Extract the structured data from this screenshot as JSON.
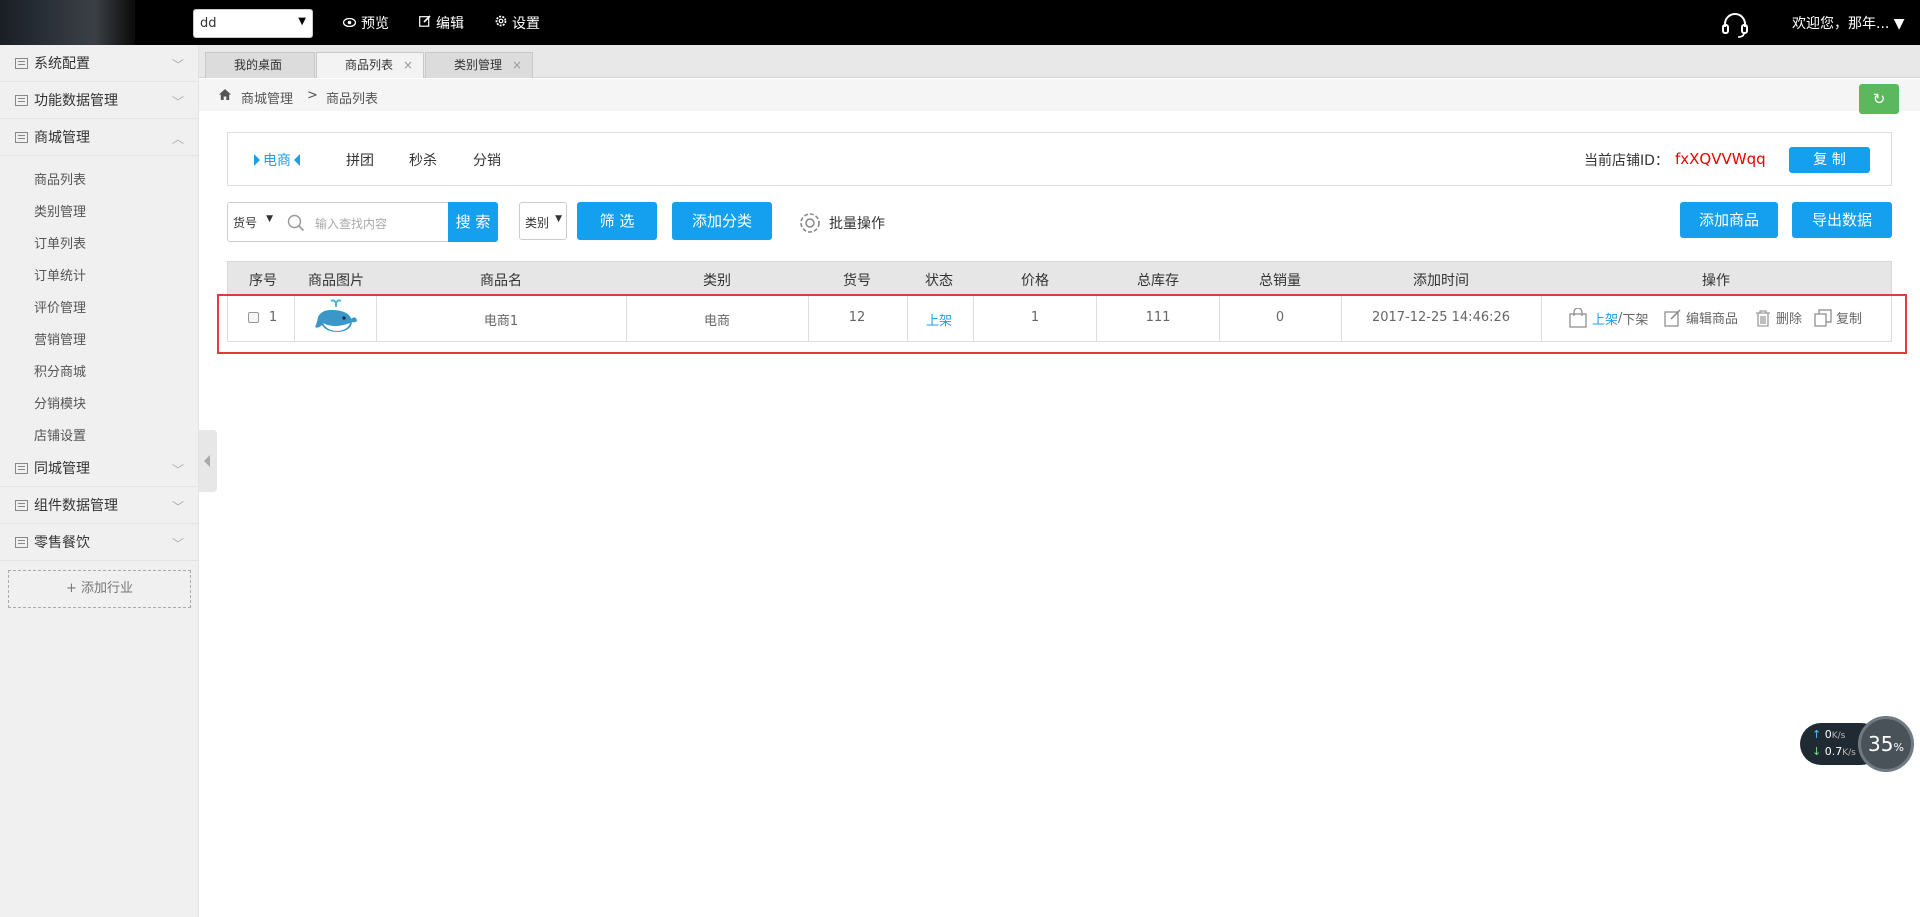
{
  "topbar": {
    "shop_selector_value": "dd",
    "nav": [
      {
        "label": "预览",
        "icon": "eye-icon"
      },
      {
        "label": "编辑",
        "icon": "edit-icon"
      },
      {
        "label": "设置",
        "icon": "gear-icon"
      }
    ],
    "welcome": "欢迎您，那年..."
  },
  "sidebar": {
    "groups_top": [
      {
        "label": "系统配置"
      },
      {
        "label": "功能数据管理"
      },
      {
        "label": "商城管理"
      }
    ],
    "sub_items": [
      "商品列表",
      "类别管理",
      "订单列表",
      "订单统计",
      "评价管理",
      "营销管理",
      "积分商城",
      "分销模块",
      "店铺设置"
    ],
    "groups_bottom": [
      {
        "label": "同城管理"
      },
      {
        "label": "组件数据管理"
      },
      {
        "label": "零售餐饮"
      }
    ],
    "add_industry": "+ 添加行业"
  },
  "tabs": [
    {
      "label": "我的桌面"
    },
    {
      "label": "商品列表",
      "close": "×"
    },
    {
      "label": "类别管理",
      "close": "×"
    }
  ],
  "breadcrumb": {
    "parent": "商城管理",
    "sep": ">",
    "current": "商品列表"
  },
  "category_tabs": [
    "电商",
    "拼团",
    "秒杀",
    "分销"
  ],
  "shop_id": {
    "label": "当前店铺ID：",
    "value": "fxXQVVWqq",
    "copy_label": "复 制"
  },
  "filters": {
    "field_select": "货号",
    "search_placeholder": "输入查找内容",
    "search_label": "搜 索",
    "type_select": "类别",
    "filter_label": "筛 选",
    "add_category_label": "添加分类",
    "batch_label": "批量操作",
    "add_product_label": "添加商品",
    "export_label": "导出数据"
  },
  "table": {
    "headers": [
      "序号",
      "商品图片",
      "商品名",
      "类别",
      "货号",
      "状态",
      "价格",
      "总库存",
      "总销量",
      "添加时间",
      "操作"
    ],
    "rows": [
      {
        "index": "1",
        "name": "电商1",
        "category": "电商",
        "sku": "12",
        "status": "上架",
        "price": "1",
        "stock": "111",
        "sales": "0",
        "added": "2017-12-25 14:46:26",
        "ops": {
          "on": "上架",
          "slash": "/",
          "off": "下架",
          "edit": "编辑商品",
          "delete": "删除",
          "copy": "复制"
        }
      }
    ]
  },
  "netmon": {
    "up": "0",
    "down": "0.7",
    "unit": "K/s",
    "percent": "35",
    "percent_sign": "%"
  },
  "colors": {
    "accent": "#14a0ee",
    "refresh": "#5cb85c",
    "highlight": "#e03c3c",
    "shop_id": "#e00000"
  }
}
